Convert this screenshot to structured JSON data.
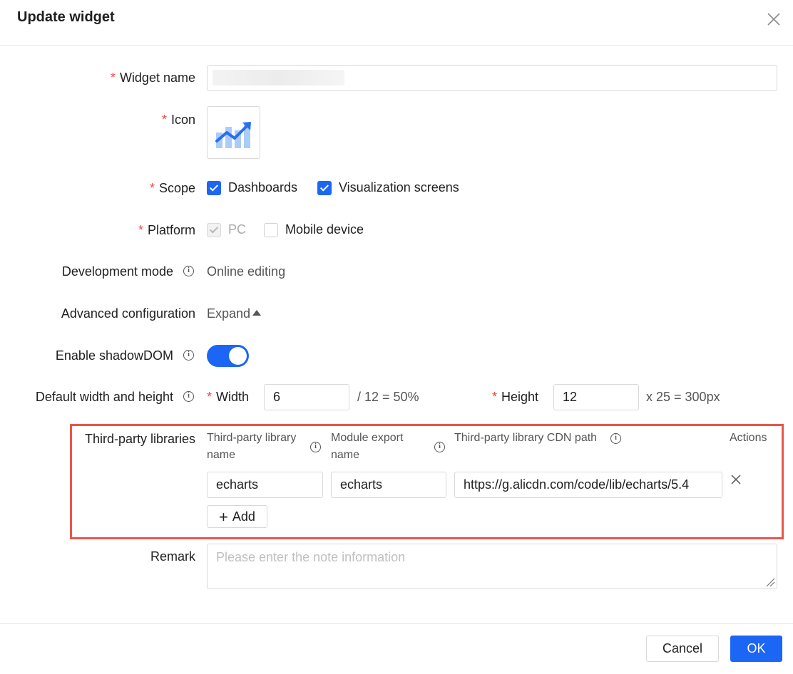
{
  "dialog": {
    "title": "Update widget"
  },
  "form": {
    "widget_name": {
      "label": "Widget name",
      "value": ""
    },
    "icon": {
      "label": "Icon",
      "icon_name": "trend-chart-icon"
    },
    "scope": {
      "label": "Scope",
      "options": [
        {
          "label": "Dashboards",
          "checked": true
        },
        {
          "label": "Visualization screens",
          "checked": true
        }
      ]
    },
    "platform": {
      "label": "Platform",
      "options": [
        {
          "label": "PC",
          "checked": true,
          "disabled": true
        },
        {
          "label": "Mobile device",
          "checked": false
        }
      ]
    },
    "development_mode": {
      "label": "Development mode",
      "value": "Online editing"
    },
    "advanced_configuration": {
      "label": "Advanced configuration",
      "value": "Expand"
    },
    "shadow_dom": {
      "label": "Enable shadowDOM",
      "enabled": true
    },
    "default_size": {
      "label": "Default width and height",
      "width_label": "Width",
      "width_value": "6",
      "width_suffix": "/ 12 = 50%",
      "height_label": "Height",
      "height_value": "12",
      "height_suffix": "x 25 = 300px"
    },
    "third_party": {
      "label": "Third-party libraries",
      "columns": {
        "name": "Third-party library name",
        "export": "Module export name",
        "cdn": "Third-party library CDN path",
        "actions": "Actions"
      },
      "rows": [
        {
          "name": "echarts",
          "export": "echarts",
          "cdn": "https://g.alicdn.com/code/lib/echarts/5.4"
        }
      ],
      "add_label": "Add"
    },
    "remark": {
      "label": "Remark",
      "placeholder": "Please enter the note information"
    }
  },
  "footer": {
    "cancel_label": "Cancel",
    "ok_label": "OK"
  },
  "colors": {
    "primary": "#1c66f5",
    "required": "#f5483b",
    "highlight_border": "#e9574b"
  }
}
